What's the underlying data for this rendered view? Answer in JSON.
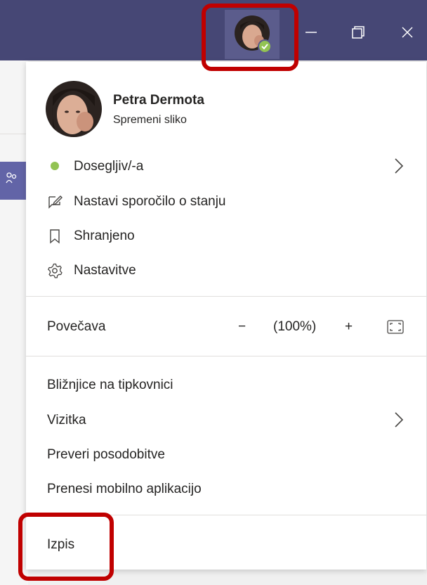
{
  "profile": {
    "name": "Petra Dermota",
    "change_photo": "Spremeni sliko"
  },
  "status": {
    "label": "Dosegljiv/-a",
    "color": "#92c353"
  },
  "menu": {
    "status_message": "Nastavi sporočilo o stanju",
    "saved": "Shranjeno",
    "settings": "Nastavitve",
    "zoom_label": "Povečava",
    "zoom_minus": "−",
    "zoom_value": "(100%)",
    "zoom_plus": "+",
    "shortcuts": "Bližnjice na tipkovnici",
    "about": "Vizitka",
    "check_updates": "Preveri posodobitve",
    "download_mobile": "Prenesi mobilno aplikacijo",
    "sign_out": "Izpis"
  },
  "colors": {
    "titlebar": "#464775",
    "accent": "#6264a7",
    "highlight": "#c00000"
  },
  "icons": [
    "chat-edit-icon",
    "bookmark-icon",
    "gear-icon",
    "chevron-right-icon",
    "fit-screen-icon",
    "minimize-icon",
    "restore-icon",
    "close-icon"
  ]
}
